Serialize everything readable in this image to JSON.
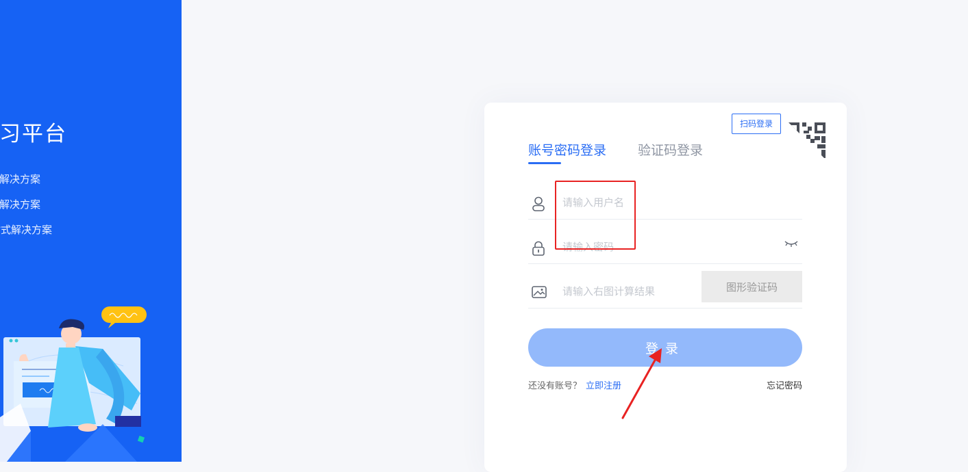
{
  "brand": {
    "title": "学习平台",
    "features": [
      "式解决方案",
      "式解决方案",
      "站式解决方案"
    ]
  },
  "login": {
    "tabs": [
      {
        "label": "账号密码登录",
        "active": true
      },
      {
        "label": "验证码登录",
        "active": false
      }
    ],
    "qr_tip": "扫码登录",
    "username": {
      "placeholder": "请输入用户名",
      "value": "",
      "icon": "user-icon"
    },
    "password": {
      "placeholder": "请输入密码",
      "value": "",
      "icon": "lock-icon"
    },
    "captcha": {
      "placeholder": "请输入右图计算结果",
      "value": "",
      "icon": "image-icon",
      "button_label": "图形验证码"
    },
    "submit_label": "登录",
    "no_account_text": "还没有账号？",
    "register_label": "立即注册",
    "forgot_label": "忘记密码"
  },
  "colors": {
    "brand_blue": "#1662f4",
    "accent": "#2a6df4",
    "button_disabled": "#93b9fb",
    "annotation_red": "#e82222"
  }
}
